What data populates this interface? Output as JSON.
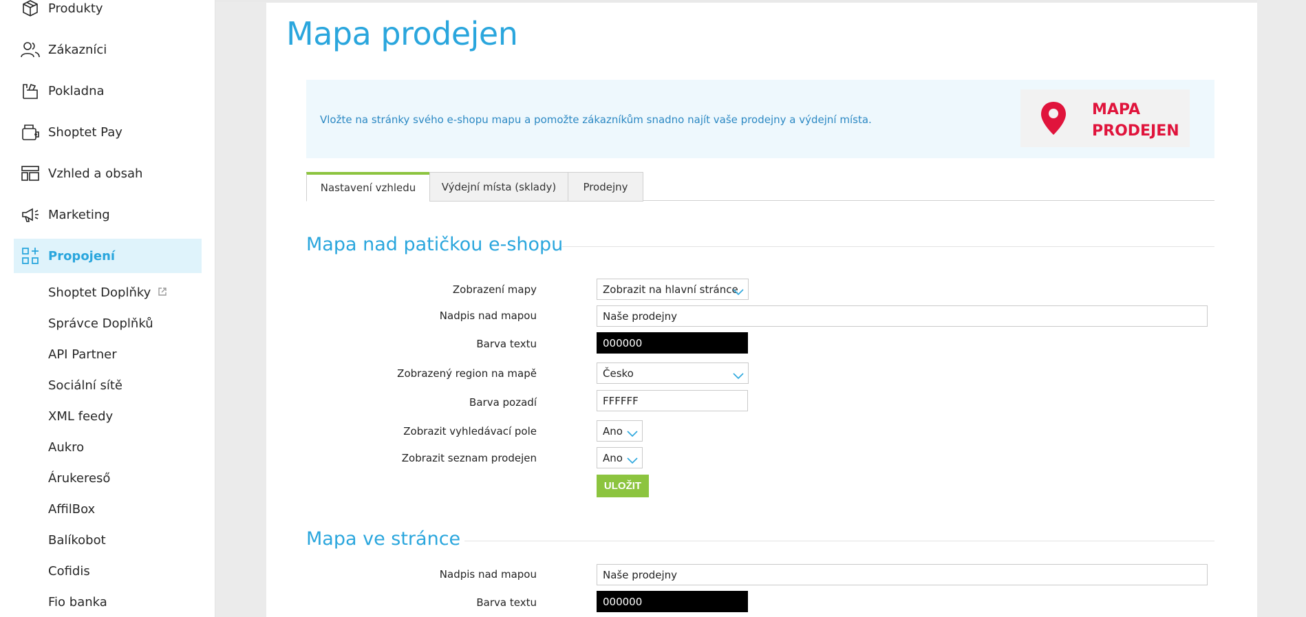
{
  "sidebar": {
    "items": [
      {
        "label": "Produkty",
        "icon": "box-icon"
      },
      {
        "label": "Zákazníci",
        "icon": "users-icon"
      },
      {
        "label": "Pokladna",
        "icon": "cash-register-icon"
      },
      {
        "label": "Shoptet Pay",
        "icon": "wallet-icon"
      },
      {
        "label": "Vzhled a obsah",
        "icon": "layout-icon"
      },
      {
        "label": "Marketing",
        "icon": "megaphone-icon"
      },
      {
        "label": "Propojení",
        "icon": "apps-icon"
      }
    ],
    "subitems": [
      {
        "label": "Shoptet Doplňky"
      },
      {
        "label": "Správce Doplňků"
      },
      {
        "label": "API Partner"
      },
      {
        "label": "Sociální sítě"
      },
      {
        "label": "XML feedy"
      },
      {
        "label": "Aukro"
      },
      {
        "label": "Árukereső"
      },
      {
        "label": "AffilBox"
      },
      {
        "label": "Balíkobot"
      },
      {
        "label": "Cofidis"
      },
      {
        "label": "Fio banka"
      }
    ]
  },
  "page": {
    "title": "Mapa prodejen"
  },
  "info": {
    "text": "Vložte na stránky svého e-shopu mapu a pomožte zákazníkům snadno najít vaše prodejny a výdejní místa.",
    "promo_line1": "MAPA",
    "promo_line2": "PRODEJEN"
  },
  "tabs": [
    {
      "label": "Nastavení vzhledu"
    },
    {
      "label": "Výdejní místa (sklady)"
    },
    {
      "label": "Prodejny"
    }
  ],
  "section1": {
    "title": "Mapa nad patičkou e-shopu",
    "map_display_label": "Zobrazení mapy",
    "map_display_value": "Zobrazit na hlavní stránce",
    "heading_label": "Nadpis nad mapou",
    "heading_value": "Naše prodejny",
    "text_color_label": "Barva textu",
    "text_color_value": "000000",
    "region_label": "Zobrazený region na mapě",
    "region_value": "Česko",
    "bg_color_label": "Barva pozadí",
    "bg_color_value": "FFFFFF",
    "search_label": "Zobrazit vyhledávací pole",
    "search_value": "Ano",
    "list_label": "Zobrazit seznam prodejen",
    "list_value": "Ano",
    "save_label": "ULOŽIT"
  },
  "section2": {
    "title": "Mapa ve stránce",
    "heading_label": "Nadpis nad mapou",
    "heading_value": "Naše prodejny",
    "text_color_label": "Barva textu",
    "text_color_value": "000000"
  },
  "colors": {
    "accent": "#2aa6dd",
    "save": "#8cc43f",
    "promo": "#e0143c"
  }
}
